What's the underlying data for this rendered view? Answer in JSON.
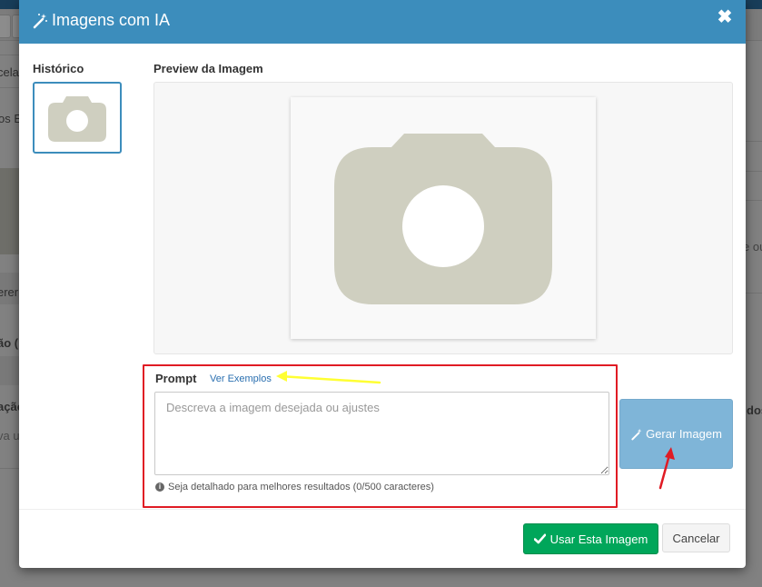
{
  "background": {
    "fragments": [
      "celar",
      "os E",
      "erer",
      "ão (",
      "ação",
      "va u",
      "e ou",
      "dos"
    ]
  },
  "modal": {
    "title": "Imagens com IA",
    "close_symbol": "✖",
    "history_label": "Histórico",
    "preview_label": "Preview da Imagem",
    "prompt": {
      "label": "Prompt",
      "examples_link": "Ver Exemplos",
      "placeholder": "Descreva a imagem desejada ou ajustes",
      "value": "",
      "hint": "Seja detalhado para melhores resultados (0/500 caracteres)"
    },
    "generate_button": "Gerar Imagem",
    "use_button": "Usar Esta Imagem",
    "cancel_button": "Cancelar"
  },
  "colors": {
    "header": "#3c8dbc",
    "generate_button": "#7fb5d8",
    "use_button": "#00a65a",
    "highlight_box": "#e01b24",
    "placeholder_icon": "#cfcfc0",
    "annotation_yellow": "#ffff33",
    "annotation_red": "#e01b24"
  },
  "icons": {
    "title": "magic-wand-icon",
    "close": "close-icon",
    "hint": "info-circle-icon",
    "generate": "magic-wand-icon",
    "use": "checkmark-icon",
    "placeholder": "camera-icon"
  }
}
